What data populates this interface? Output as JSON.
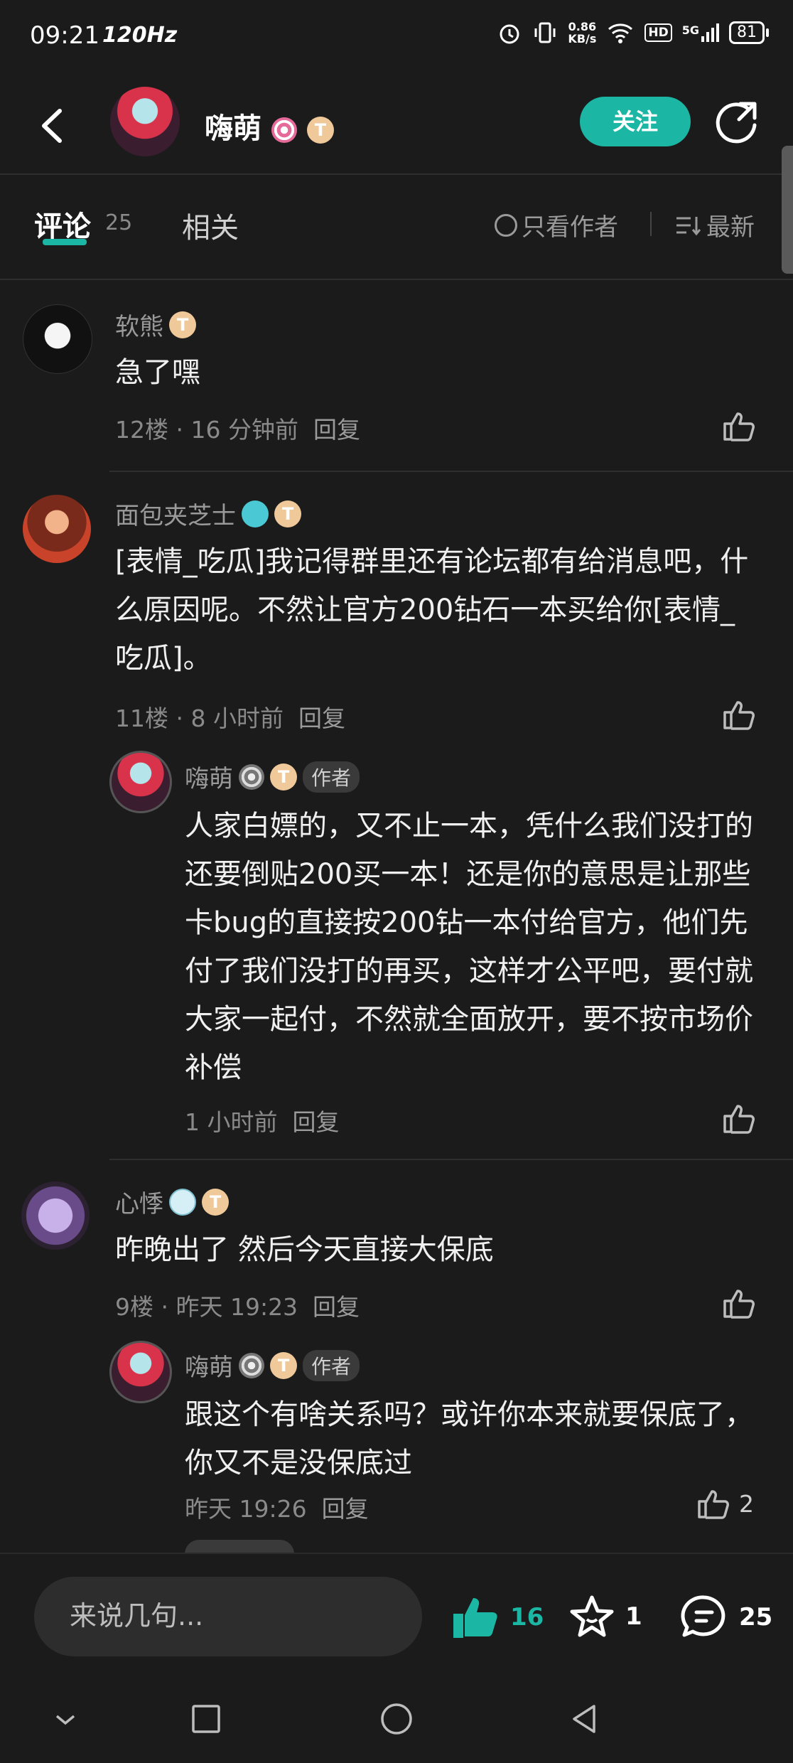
{
  "status_bar": {
    "time": "09:21",
    "refresh": "120Hz",
    "net_speed": "0.86",
    "net_unit": "KB/s",
    "hd": "HD",
    "signal": "5G",
    "battery": "81"
  },
  "header": {
    "name": "嗨萌",
    "level_badge": "T",
    "follow_label": "关注"
  },
  "tabs": {
    "comments_label": "评论",
    "comments_count": "25",
    "related_label": "相关",
    "only_author_label": "只看作者",
    "sort_label": "最新"
  },
  "comments": [
    {
      "user": "软熊",
      "badge": "T",
      "text": "急了嘿",
      "meta": "12楼 · 16 分钟前",
      "reply": "回复"
    },
    {
      "user": "面包夹芝士",
      "badge": "T",
      "text": "[表情_吃瓜]我记得群里还有论坛都有给消息吧，什么原因呢。不然让官方200钻石一本买给你[表情_吃瓜]。",
      "meta": "11楼 · 8 小时前",
      "reply": "回复",
      "sub": {
        "user": "嗨萌",
        "badge": "T",
        "tag": "作者",
        "text": "人家白嫖的，又不止一本，凭什么我们没打的还要倒贴200买一本！还是你的意思是让那些卡bug的直接按200钻一本付给官方，他们先付了我们没打的再买，这样才公平吧，要付就大家一起付，不然就全面放开，要不按市场价补偿",
        "meta": "1 小时前",
        "reply": "回复"
      }
    },
    {
      "user": "心悸",
      "badge": "T",
      "text": "昨晚出了  然后今天直接大保底",
      "meta": "9楼 · 昨天 19:23",
      "reply": "回复",
      "sub": {
        "user": "嗨萌",
        "badge": "T",
        "tag": "作者",
        "text": "跟这个有啥关系吗？或许你本来就要保底了，你又不是没保底过",
        "meta": "昨天 19:26",
        "reply": "回复",
        "likes": "2"
      }
    }
  ],
  "bottom": {
    "placeholder": "来说几句...",
    "likes": "16",
    "stars": "1",
    "comments": "25"
  },
  "colors": {
    "accent": "#1bb7a4",
    "background": "#1b1b1b"
  }
}
